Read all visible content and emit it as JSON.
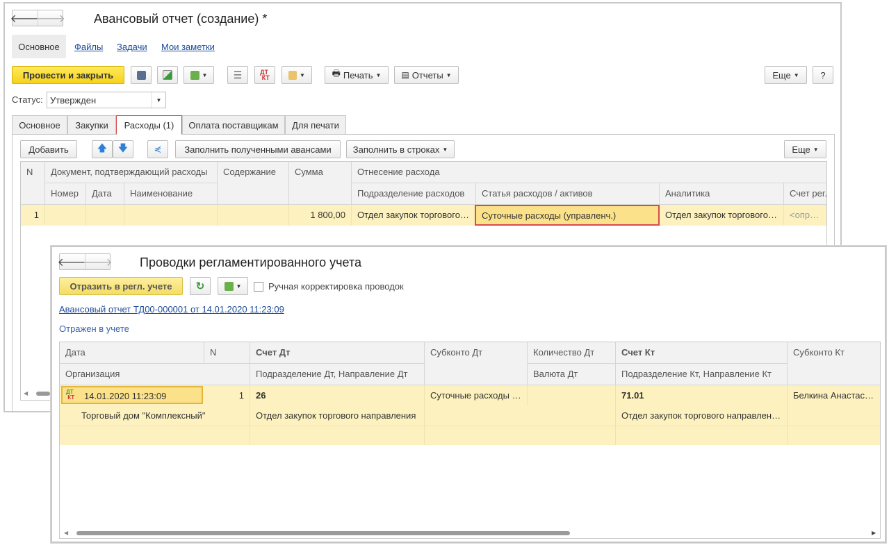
{
  "main": {
    "title": "Авансовый отчет (создание) *",
    "top_tabs": [
      "Основное",
      "Файлы",
      "Задачи",
      "Мои заметки"
    ],
    "post_and_close": "Провести и закрыть",
    "print": "Печать",
    "reports": "Отчеты",
    "more": "Еще",
    "help": "?",
    "status_label": "Статус:",
    "status_value": "Утвержден",
    "tabs": [
      "Основное",
      "Закупки",
      "Расходы (1)",
      "Оплата поставщикам",
      "Для печати"
    ],
    "add": "Добавить",
    "fill_advances": "Заполнить полученными авансами",
    "fill_rows": "Заполнить в строках",
    "more2": "Еще",
    "grid": {
      "h_n": "N",
      "h_doc": "Документ, подтверждающий расходы",
      "h_content": "Содержание",
      "h_sum": "Сумма",
      "h_attr": "Отнесение расхода",
      "h_number": "Номер",
      "h_date": "Дата",
      "h_name": "Наименование",
      "h_dept": "Подразделение расходов",
      "h_item": "Статья расходов / активов",
      "h_analytics": "Аналитика",
      "h_account": "Счет регл",
      "row": {
        "n": "1",
        "sum": "1 800,00",
        "dept": "Отдел закупок торгового…",
        "item": "Суточные расходы (управленч.)",
        "analytics": "Отдел закупок торгового…",
        "account": "<определ"
      }
    }
  },
  "popup": {
    "title": "Проводки регламентированного учета",
    "reflect_btn": "Отразить в регл. учете",
    "manual_label": "Ручная корректировка проводок",
    "doc_link": "Авансовый отчет ТД00-000001 от 14.01.2020 11:23:09",
    "status": "Отражен в учете",
    "grid": {
      "h_date": "Дата",
      "h_n": "N",
      "h_dt": "Счет Дт",
      "h_sub_dt": "Субконто Дт",
      "h_qty_dt": "Количество Дт",
      "h_kt": "Счет Кт",
      "h_sub_kt": "Субконто Кт",
      "h_org": "Организация",
      "h_dept_dt": "Подразделение Дт, Направление Дт",
      "h_cur_dt": "Валюта Дт",
      "h_dept_kt": "Подразделение Кт, Направление Кт",
      "row": {
        "date": "14.01.2020 11:23:09",
        "n": "1",
        "dt": "26",
        "sub_dt": "Суточные расходы …",
        "kt": "71.01",
        "sub_kt": "Белкина Анастасия…",
        "org": "Торговый дом \"Комплексный\"",
        "dept_dt": "Отдел закупок торгового направления",
        "dept_kt": "Отдел закупок торгового направления"
      }
    }
  },
  "colors": {
    "accent_yellow": "#f5d21b",
    "link": "#1a4a9a",
    "row_highlight": "#fdf2bf",
    "active_tab_border": "#d94a4a"
  }
}
